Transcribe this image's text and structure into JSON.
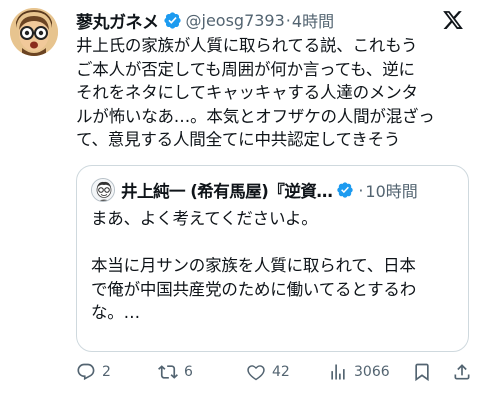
{
  "tweet": {
    "author_name": "蓼丸ガネメ",
    "handle": "@jeosg7393",
    "separator": "·",
    "time": "4時間",
    "text": "井上氏の家族が人質に取られてる説、これもう\nご本人が否定しても周囲が何か言っても、逆に\nそれをネタにしてキャッキャする人達のメンタ\nルが怖いなあ…。本気とオフザケの人間が混ざっ\nて、意見する人間全てに中共認定してきそう"
  },
  "quote": {
    "author_name": "井上純一 (希有馬屋)『逆資…",
    "separator": "·",
    "time": "10時間",
    "text": "まあ、よく考えてくださいよ。\n\n本当に月サンの家族を人質に取られて、日本\nで俺が中国共産党のために働いてるとするわ\nな。…"
  },
  "actions": {
    "replies": "2",
    "retweets": "6",
    "likes": "42",
    "views": "3066"
  },
  "icons": {
    "verified": "verified-badge-icon",
    "x_logo": "x-logo-icon",
    "reply": "reply-icon",
    "retweet": "retweet-icon",
    "like": "like-icon",
    "views": "views-icon",
    "bookmark": "bookmark-icon",
    "share": "share-icon"
  },
  "colors": {
    "verified": "#1d9bf0",
    "text": "#0f1419",
    "secondary": "#536471",
    "border": "#cfd9de"
  }
}
